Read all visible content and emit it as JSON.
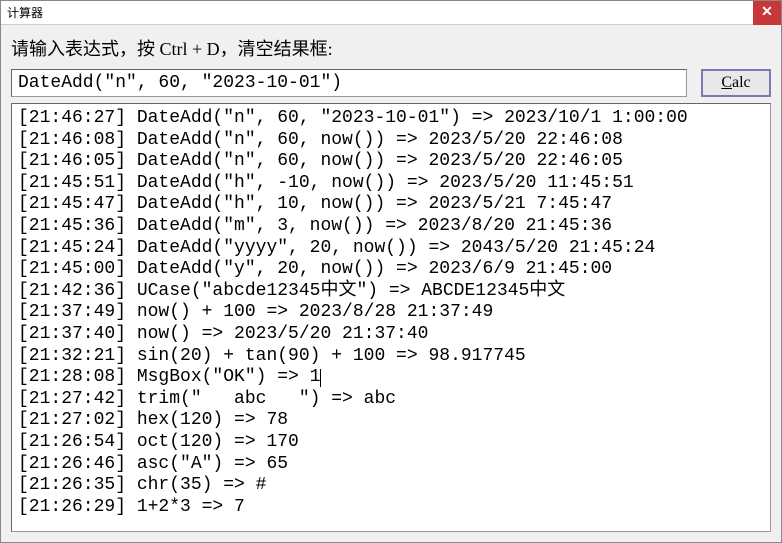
{
  "window": {
    "title": "计算器",
    "close_label": "✕"
  },
  "prompt": "请输入表达式，按 Ctrl + D，清空结果框:",
  "input": {
    "value": "DateAdd(\"n\", 60, \"2023-10-01\")"
  },
  "calc_button": {
    "prefix": "C",
    "rest": "alc"
  },
  "results": [
    "[21:46:27] DateAdd(\"n\", 60, \"2023-10-01\") => 2023/10/1 1:00:00",
    "[21:46:08] DateAdd(\"n\", 60, now()) => 2023/5/20 22:46:08",
    "[21:46:05] DateAdd(\"n\", 60, now()) => 2023/5/20 22:46:05",
    "[21:45:51] DateAdd(\"h\", -10, now()) => 2023/5/20 11:45:51",
    "[21:45:47] DateAdd(\"h\", 10, now()) => 2023/5/21 7:45:47",
    "[21:45:36] DateAdd(\"m\", 3, now()) => 2023/8/20 21:45:36",
    "[21:45:24] DateAdd(\"yyyy\", 20, now()) => 2043/5/20 21:45:24",
    "[21:45:00] DateAdd(\"y\", 20, now()) => 2023/6/9 21:45:00",
    "[21:42:36] UCase(\"abcde12345中文\") => ABCDE12345中文",
    "[21:37:49] now() + 100 => 2023/8/28 21:37:49",
    "[21:37:40] now() => 2023/5/20 21:37:40",
    "[21:32:21] sin(20) + tan(90) + 100 => 98.917745",
    "[21:28:08] MsgBox(\"OK\") => 1",
    "[21:27:42] trim(\"   abc   \") => abc",
    "[21:27:02] hex(120) => 78",
    "[21:26:54] oct(120) => 170",
    "[21:26:46] asc(\"A\") => 65",
    "[21:26:35] chr(35) => #",
    "[21:26:29] 1+2*3 => 7"
  ],
  "cursor_line_index": 12
}
